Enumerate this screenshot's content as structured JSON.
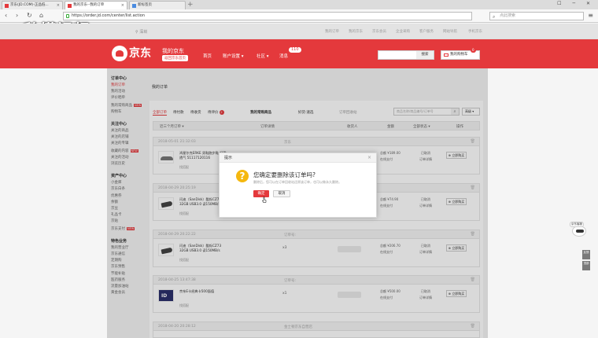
{
  "browser": {
    "tabs": [
      {
        "title": "京东(JD.COM)-正品低..."
      },
      {
        "title": "我的京东--我的订单"
      },
      {
        "title": "新标签页"
      }
    ],
    "new_tab": "+",
    "window_controls": "☐ ─ ✕",
    "url": "https://order.jd.com/center/list.action",
    "search_placeholder": "点此搜索"
  },
  "watermark": "秒懂视频",
  "topbar": {
    "location": "深圳",
    "items": [
      "我的订单",
      "我的京东",
      "京东会员",
      "企业采购",
      "客户服务",
      "网站导航",
      "手机京东"
    ]
  },
  "header": {
    "brand": "京东",
    "my_jd": "我的京东",
    "home_button": "返回京东首页",
    "nav": [
      "首页",
      "账户设置",
      "社区",
      "消息"
    ],
    "message_badge": "110",
    "search_button": "搜索",
    "cart_label": "我的购物车",
    "cart_count": "0"
  },
  "sidebar": {
    "groups": [
      {
        "title": "订单中心",
        "items": [
          {
            "label": "我的订单",
            "active": true
          },
          {
            "label": "我的活动"
          },
          {
            "label": "评价晒单"
          },
          {
            "label": "我的常购商品",
            "hot": "NEW"
          },
          {
            "label": "购物车"
          }
        ]
      },
      {
        "title": "关注中心",
        "items": [
          {
            "label": "关注的商品"
          },
          {
            "label": "关注的店铺"
          },
          {
            "label": "关注的专辑"
          },
          {
            "label": "收藏的内容",
            "hot": "NEW"
          },
          {
            "label": "关注的活动"
          },
          {
            "label": "浏览历史"
          }
        ]
      },
      {
        "title": "资产中心",
        "items": [
          {
            "label": "小金库"
          },
          {
            "label": "京东白条"
          },
          {
            "label": "优惠券"
          },
          {
            "label": "余额"
          },
          {
            "label": "京豆"
          },
          {
            "label": "礼品卡"
          },
          {
            "label": "京贴"
          },
          {
            "label": "京东支付",
            "hot": "NEW"
          }
        ]
      },
      {
        "title": "特色业务",
        "items": [
          {
            "label": "我的营业厅"
          },
          {
            "label": "京东通信"
          },
          {
            "label": "定期购"
          },
          {
            "label": "京东预售"
          },
          {
            "label": "节能补贴"
          },
          {
            "label": "医药服务"
          },
          {
            "label": "流量加油站"
          },
          {
            "label": "黄金会员"
          }
        ]
      }
    ]
  },
  "main": {
    "title": "我的订单",
    "tabs": [
      {
        "label": "全部订单",
        "active": true
      },
      {
        "label": "待付款"
      },
      {
        "label": "待收货"
      },
      {
        "label": "待评价",
        "count": "2"
      }
    ],
    "mid_links": [
      "我的常购商品",
      "好货·速选",
      "订单回收站"
    ],
    "search_placeholder": "商品名称/商品编号/订单号",
    "more_button": "高级",
    "columns": [
      "近三个月订单",
      "订单详情",
      "收货人",
      "金额",
      "全部状态",
      "操作"
    ],
    "orders": [
      {
        "time": "2018-05-01 21:32:03",
        "shop": "京东",
        "img": "shoe",
        "name": "鸿星尔克ERKE 男鞋跑步鞋 轻盈透气 51117120116",
        "qty": "",
        "price": "总额 ¥189.00",
        "pay": "在线支付",
        "status": "已取消",
        "detail": "订单详情",
        "action": "立即购买",
        "service": "找搭配"
      },
      {
        "time": "2018-04-29 20:25:19",
        "shop": "订单号:",
        "img": "usb",
        "name": "闪迪（SanDisk）酷铄CZ73 32GB USB3.0 读150MB/s",
        "qty": "",
        "price": "总额 ¥74.90",
        "pay": "在线支付",
        "status": "已取消",
        "detail": "订单详情",
        "action": "立即购买",
        "service": "找搭配"
      },
      {
        "time": "2018-04-29 20:22:22",
        "shop": "订单号:",
        "img": "usb",
        "name": "闪迪（SanDisk）酷铄CZ73 32GB USB3.0 读150MB/s",
        "qty": "x3",
        "price": "总额 ¥206.70",
        "pay": "在线支付",
        "status": "已取消",
        "detail": "订单详情",
        "action": "立即购买",
        "service": "找搭配"
      },
      {
        "time": "2018-04-25 13:47:38",
        "shop": "订单号:",
        "img": "card",
        "name": "京东E卡经典卡500面值",
        "qty": "x1",
        "price": "总额 ¥500.00",
        "pay": "在线支付",
        "status": "已取消",
        "detail": "订单详情",
        "action": "立即购买",
        "service": "找搭配"
      },
      {
        "time": "2018-04-20 20:28:12",
        "shop": "金士顿京东自营店",
        "img": "usb",
        "name": "",
        "qty": "",
        "price": "",
        "pay": "",
        "status": "",
        "detail": "",
        "action": "",
        "service": ""
      }
    ]
  },
  "dialog": {
    "title": "提示",
    "question": "您确定要删除该订单吗?",
    "sub": "删除后，您可以在订单回收站还原该订单，也可以做永久删除。",
    "ok": "确定",
    "cancel": "取消"
  },
  "right_widget": {
    "robot_label": "京东客服",
    "buttons": [
      "反馈",
      "顶部"
    ]
  },
  "colors": {
    "brand_red": "#e4393c",
    "warning_yellow": "#f5b80f"
  }
}
